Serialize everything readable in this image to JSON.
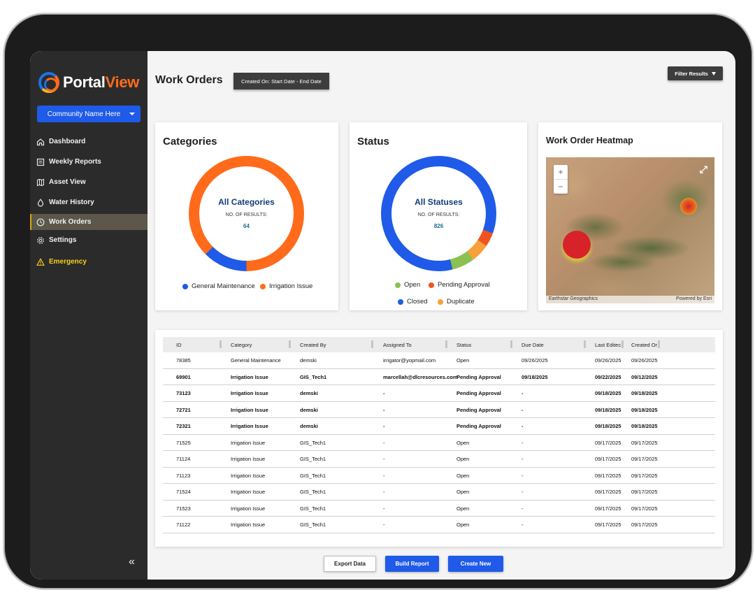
{
  "brand": {
    "name_part1": "Portal",
    "name_part2": "View"
  },
  "community_select": {
    "value": "Community Name Here"
  },
  "sidebar": {
    "items": [
      {
        "label": "Dashboard",
        "icon": "home-icon"
      },
      {
        "label": "Weekly Reports",
        "icon": "report-icon"
      },
      {
        "label": "Asset View",
        "icon": "map-icon"
      },
      {
        "label": "Water History",
        "icon": "droplet-icon"
      },
      {
        "label": "Work Orders",
        "icon": "clock-icon",
        "active": true
      },
      {
        "label": "Settings",
        "icon": "gear-icon"
      },
      {
        "label": "Emergency",
        "icon": "warning-icon",
        "accent": "#f4d21c"
      }
    ]
  },
  "header": {
    "title": "Work Orders",
    "date_filter": "Created On: Start Date - End Date",
    "filter_button": "Filter Results"
  },
  "categories_card": {
    "title": "Categories",
    "center_title": "All Categories",
    "results_label": "NO. OF RESULTS:",
    "results_count": "64",
    "legend": [
      {
        "label": "General Maintenance",
        "color": "#1f5be8"
      },
      {
        "label": "Irrigation Issue",
        "color": "#ff6b1a"
      }
    ]
  },
  "status_card": {
    "title": "Status",
    "center_title": "All Statuses",
    "results_label": "NO. OF RESULTS:",
    "results_count": "826",
    "legend": [
      {
        "label": "Open",
        "color": "#8cc152"
      },
      {
        "label": "Pending Approval",
        "color": "#f0541e"
      },
      {
        "label": "Closed",
        "color": "#1f5be8"
      },
      {
        "label": "Duplicate",
        "color": "#f7a13a"
      }
    ]
  },
  "heatmap_card": {
    "title": "Work Order Heatmap",
    "attribution_left": "Earthstar Geographics",
    "attribution_right": "Powered by Esri",
    "zoom_in": "+",
    "zoom_out": "−"
  },
  "table": {
    "columns": [
      "ID",
      "Category",
      "Created By",
      "Assigned To",
      "Status",
      "Due Date",
      "Last Editec",
      "Created Or"
    ],
    "rows": [
      {
        "bold": false,
        "cells": [
          "78385",
          "General Maintenance",
          "demski",
          "irrigator@yopmail.com",
          "Open",
          "09/26/2025",
          "09/26/2025",
          "09/26/2025"
        ]
      },
      {
        "bold": true,
        "cells": [
          "69901",
          "Irrigation Issue",
          "GIS_Tech1",
          "marcellah@dlcresources.com",
          "Pending Approval",
          "09/18/2025",
          "09/22/2025",
          "09/12/2025"
        ]
      },
      {
        "bold": true,
        "cells": [
          "73123",
          "Irrigation Issue",
          "demski",
          "-",
          "Pending Approval",
          "-",
          "09/18/2025",
          "09/18/2025"
        ]
      },
      {
        "bold": true,
        "cells": [
          "72721",
          "Irrigation Issue",
          "demski",
          "-",
          "Pending Approval",
          "-",
          "09/18/2025",
          "09/18/2025"
        ]
      },
      {
        "bold": true,
        "cells": [
          "72321",
          "Irrigation Issue",
          "demski",
          "-",
          "Pending Approval",
          "-",
          "09/18/2025",
          "09/18/2025"
        ]
      },
      {
        "bold": false,
        "cells": [
          "71525",
          "Irrigation Issue",
          "GIS_Tech1",
          "-",
          "Open",
          "-",
          "09/17/2025",
          "09/17/2025"
        ]
      },
      {
        "bold": false,
        "cells": [
          "71124",
          "Irrigation Issue",
          "GIS_Tech1",
          "-",
          "Open",
          "-",
          "09/17/2025",
          "09/17/2025"
        ]
      },
      {
        "bold": false,
        "cells": [
          "71123",
          "Irrigation Issue",
          "GIS_Tech1",
          "-",
          "Open",
          "-",
          "09/17/2025",
          "09/17/2025"
        ]
      },
      {
        "bold": false,
        "cells": [
          "71524",
          "Irrigation Issue",
          "GIS_Tech1",
          "-",
          "Open",
          "-",
          "09/17/2025",
          "09/17/2025"
        ]
      },
      {
        "bold": false,
        "cells": [
          "71523",
          "Irrigation Issue",
          "GIS_Tech1",
          "-",
          "Open",
          "-",
          "09/17/2025",
          "09/17/2025"
        ]
      },
      {
        "bold": false,
        "cells": [
          "71122",
          "Irrigation Issue",
          "GIS_Tech1",
          "-",
          "Open",
          "-",
          "09/17/2025",
          "09/17/2025"
        ]
      }
    ]
  },
  "footer": {
    "export": "Export Data",
    "build": "Build Report",
    "create": "Create New"
  },
  "colors": {
    "primary": "#1f5be8",
    "accent_orange": "#ff6b1a",
    "sidebar_bg": "#2b2b2b"
  }
}
